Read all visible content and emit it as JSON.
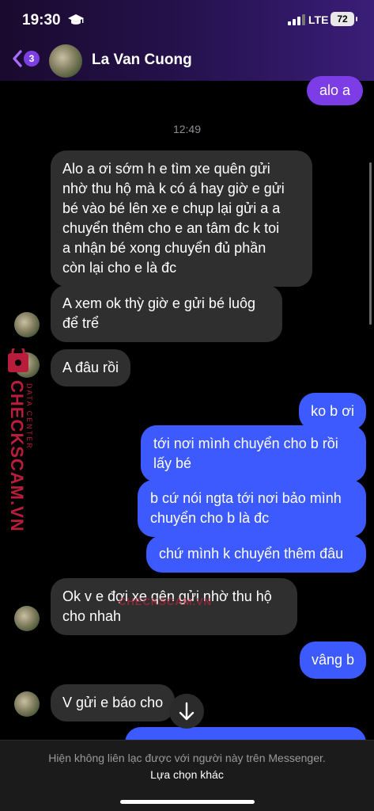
{
  "status_bar": {
    "time": "19:30",
    "network": "LTE",
    "battery": "72"
  },
  "header": {
    "back_badge": "3",
    "contact_name": "La Van Cuong"
  },
  "messages": {
    "out_alo": "alo a",
    "timestamp": "12:49",
    "in_1": "Alo a ơi sớm h e tìm xe quên gửi\nnhờ thu hộ mà k có á hay giờ e gửi\nbé vào bé lên xe e chụp lại gửi a a\nchuyển thêm cho e an tâm đc k toi\na nhận bé xong chuyển đủ phần\ncòn lại cho e là đc",
    "in_2": "A xem ok thỳ giờ e gửi bé luôg\nđể trể",
    "in_3": "A đâu rồi",
    "out_1": "ko b ơi",
    "out_2": "tới nơi mình chuyển cho b rồi\nlấy bé",
    "out_3": "b cứ nói ngta tới nơi bảo mình\nchuyển cho b là đc",
    "out_4": "chứ mình k chuyển thêm đâu",
    "in_4": "Ok v e đợi xe qên gửi nhờ thu hộ\ncho nhah",
    "out_5": "vâng b",
    "in_5": "V gửi e báo cho"
  },
  "watermark": {
    "brand": "CHECKSCAM.VN",
    "sub": "DATA CENTER",
    "center": "CHECKSCAM.VN"
  },
  "footer": {
    "note": "Hiện không liên lạc được với người này trên Messenger.",
    "link": "Lựa chọn khác"
  },
  "colors": {
    "outgoing": "#3d5afe",
    "incoming": "#2f2f2f",
    "accent": "#7b3fe4",
    "watermark": "#b81d3c"
  },
  "icons": [
    "graduation-cap-icon",
    "signal-icon",
    "battery-icon",
    "back-chevron-icon",
    "arrow-down-icon",
    "checkscam-logo-icon"
  ]
}
